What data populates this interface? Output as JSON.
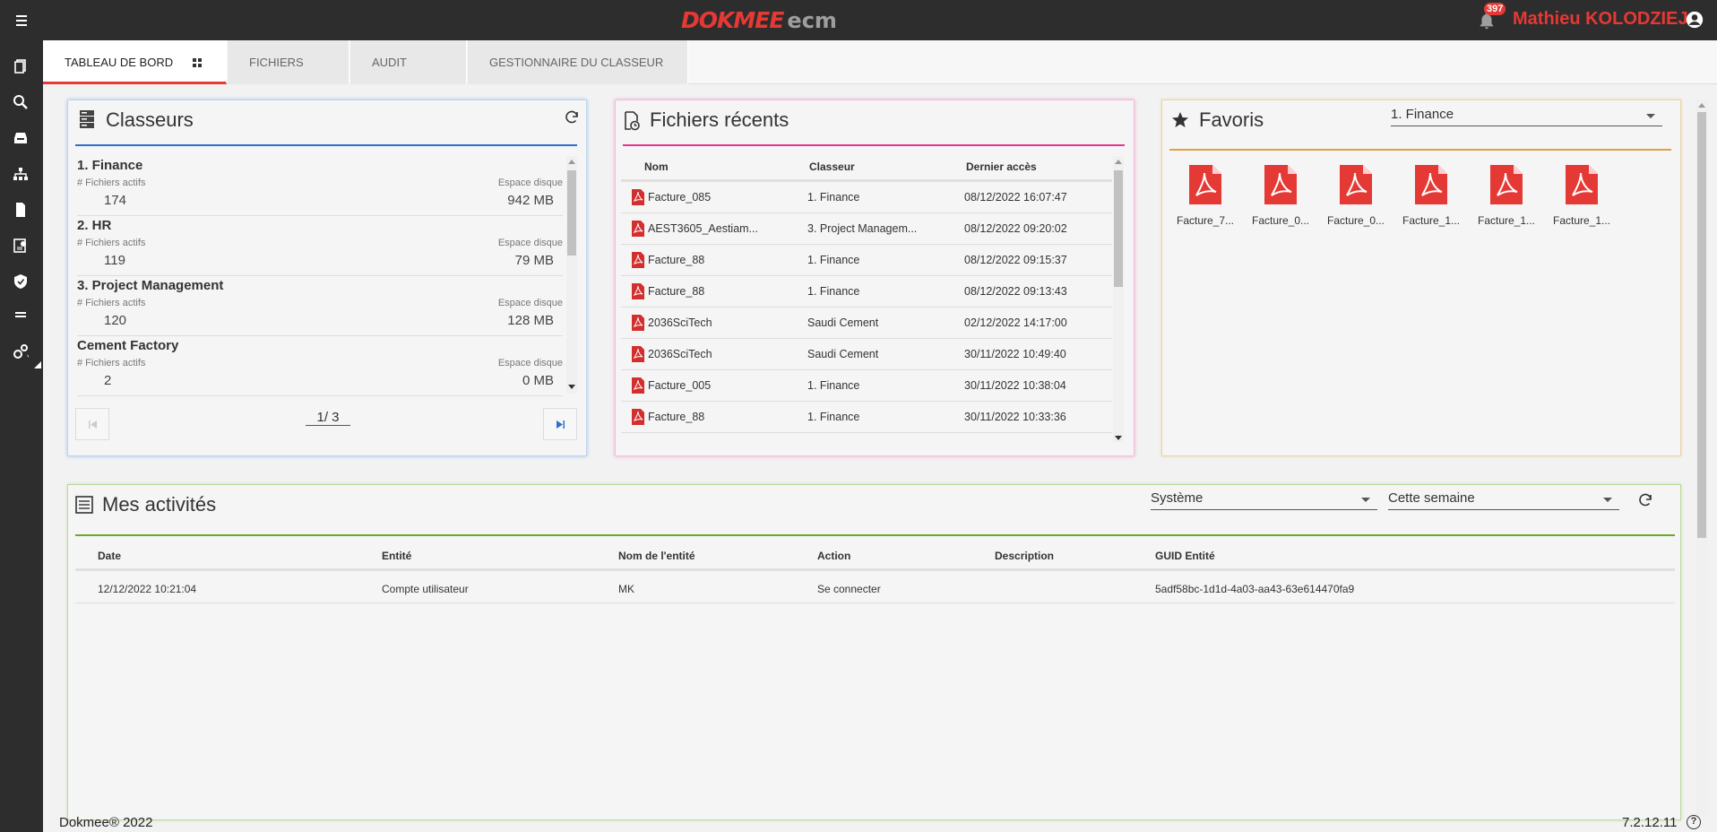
{
  "header": {
    "brand": "DOKMEE",
    "brand_suffix": "ecm",
    "notifications_count": "397",
    "user_name": "Mathieu KOLODZIEJ"
  },
  "tabs": [
    {
      "label": "TABLEAU DE BORD",
      "active": true
    },
    {
      "label": "FICHIERS"
    },
    {
      "label": "AUDIT"
    },
    {
      "label": "GESTIONNAIRE DU CLASSEUR"
    }
  ],
  "classeurs": {
    "title": "Classeurs",
    "items": [
      {
        "name": "1. Finance",
        "label_files": "# Fichiers actifs",
        "files": "174",
        "label_disk": "Espace disque",
        "disk": "942 MB"
      },
      {
        "name": "2. HR",
        "label_files": "# Fichiers actifs",
        "files": "119",
        "label_disk": "Espace disque",
        "disk": "79 MB"
      },
      {
        "name": "3. Project Management",
        "label_files": "# Fichiers actifs",
        "files": "120",
        "label_disk": "Espace disque",
        "disk": "128 MB"
      },
      {
        "name": "Cement Factory",
        "label_files": "# Fichiers actifs",
        "files": "2",
        "label_disk": "Espace disque",
        "disk": "0 MB"
      }
    ],
    "page": "1/ 3"
  },
  "recent": {
    "title": "Fichiers récents",
    "columns": [
      "Nom",
      "Classeur",
      "Dernier accès"
    ],
    "rows": [
      [
        "Facture_085",
        "1. Finance",
        "08/12/2022 16:07:47"
      ],
      [
        "AEST3605_Aestiam...",
        "3. Project Managem...",
        "08/12/2022 09:20:02"
      ],
      [
        "Facture_88",
        "1. Finance",
        "08/12/2022 09:15:37"
      ],
      [
        "Facture_88",
        "1. Finance",
        "08/12/2022 09:13:43"
      ],
      [
        "2036SciTech",
        "Saudi Cement",
        "02/12/2022 14:17:00"
      ],
      [
        "2036SciTech",
        "Saudi Cement",
        "30/11/2022 10:49:40"
      ],
      [
        "Facture_005",
        "1. Finance",
        "30/11/2022 10:38:04"
      ],
      [
        "Facture_88",
        "1. Finance",
        "30/11/2022 10:33:36"
      ]
    ]
  },
  "favoris": {
    "title": "Favoris",
    "selected": "1. Finance",
    "items": [
      "Facture_7...",
      "Facture_0...",
      "Facture_0...",
      "Facture_1...",
      "Facture_1...",
      "Facture_1..."
    ]
  },
  "activities": {
    "title": "Mes activités",
    "filter_type": "Système",
    "filter_period": "Cette semaine",
    "columns": [
      "Date",
      "Entité",
      "Nom de l'entité",
      "Action",
      "Description",
      "GUID Entité"
    ],
    "rows": [
      [
        "12/12/2022 10:21:04",
        "Compte utilisateur",
        "MK",
        "Se connecter",
        "",
        "5adf58bc-1d1d-4a03-aa43-63e614470fa9"
      ]
    ]
  },
  "footer": {
    "copyright": "Dokmee® 2022",
    "version": "7.2.12.11"
  },
  "colors": {
    "brand_red": "#e53935",
    "classeurs_accent": "#2f6fc6",
    "recent_accent": "#e8338f",
    "favoris_accent": "#e0a040",
    "activities_accent": "#6aaa2a"
  }
}
